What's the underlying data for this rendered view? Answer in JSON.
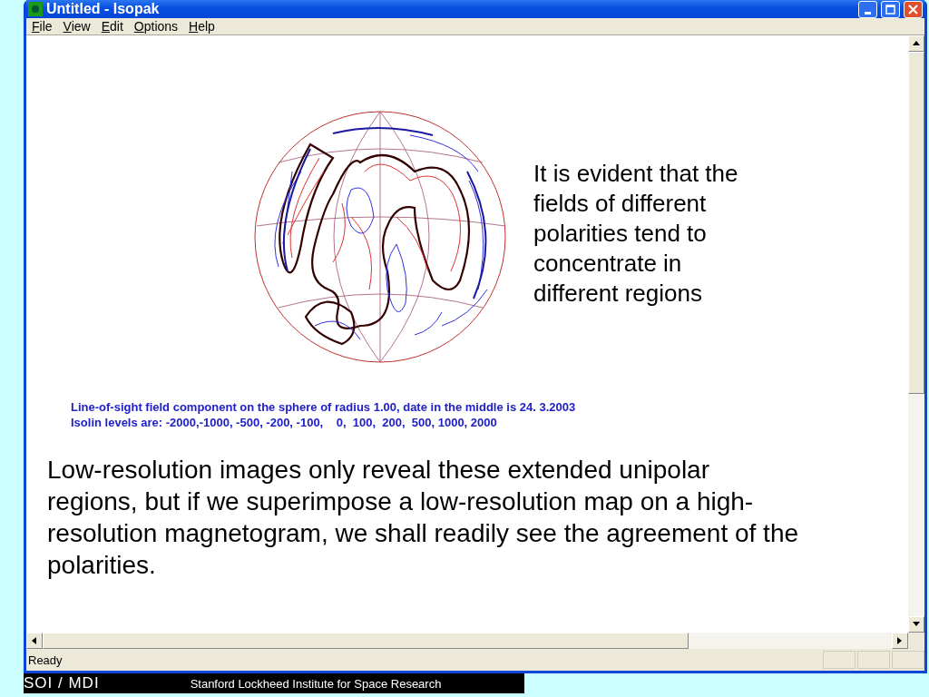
{
  "window": {
    "title": "Untitled - Isopak"
  },
  "menu": [
    {
      "label": "File"
    },
    {
      "label": "View"
    },
    {
      "label": "Edit"
    },
    {
      "label": "Options"
    },
    {
      "label": "Help"
    }
  ],
  "content": {
    "side_note": "It is evident that the fields of different polarities tend to concentrate in different regions",
    "caption_lines": [
      "Line-of-sight field component on the sphere of radius 1.00, date in the middle is 24. 3.2003",
      "Isolin levels are: -2000,-1000, -500, -200, -100,    0,  100,  200,  500, 1000, 2000"
    ],
    "paragraph": "Low-resolution images only reveal these extended unipolar regions, but if we superimpose a low-resolution map on a high-resolution magnetogram, we shall readily see the agreement of the polarities."
  },
  "status_bar": {
    "text": "Ready"
  },
  "footer": {
    "left": "SOI / MDI",
    "right": "Stanford Lockheed Institute for Space Research"
  }
}
